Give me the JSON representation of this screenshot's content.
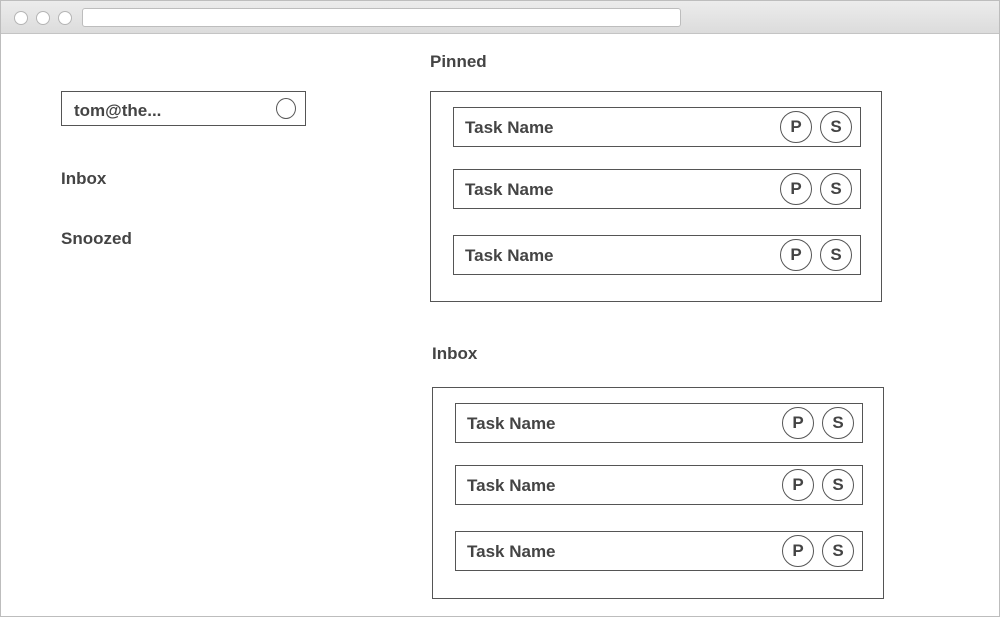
{
  "account": {
    "email": "tom@the..."
  },
  "sidebar": {
    "items": [
      {
        "label": "Inbox"
      },
      {
        "label": "Snoozed"
      }
    ]
  },
  "sections": [
    {
      "title": "Pinned",
      "tasks": [
        {
          "name": "Task Name",
          "pin_label": "P",
          "snooze_label": "S"
        },
        {
          "name": "Task Name",
          "pin_label": "P",
          "snooze_label": "S"
        },
        {
          "name": "Task Name",
          "pin_label": "P",
          "snooze_label": "S"
        }
      ]
    },
    {
      "title": "Inbox",
      "tasks": [
        {
          "name": "Task Name",
          "pin_label": "P",
          "snooze_label": "S"
        },
        {
          "name": "Task Name",
          "pin_label": "P",
          "snooze_label": "S"
        },
        {
          "name": "Task Name",
          "pin_label": "P",
          "snooze_label": "S"
        }
      ]
    }
  ]
}
